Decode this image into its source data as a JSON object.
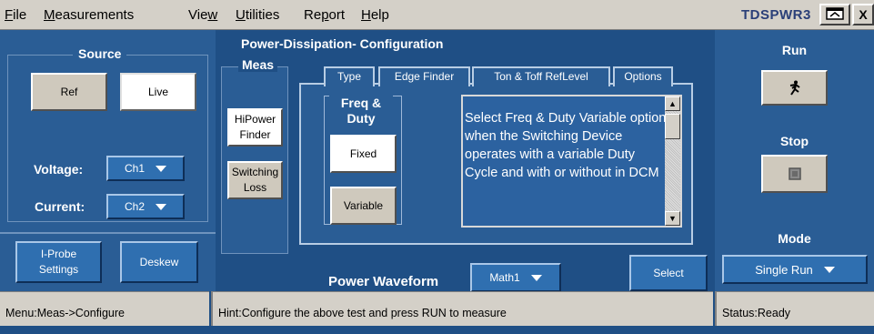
{
  "menu": {
    "items": [
      {
        "first": "F",
        "rest": "ile"
      },
      {
        "first": "M",
        "rest": "easurements"
      },
      {
        "pre": "Vie",
        "first": "w",
        "rest": ""
      },
      {
        "first": "U",
        "rest": "tilities"
      },
      {
        "pre": "Re",
        "first": "p",
        "rest": "ort"
      },
      {
        "first": "H",
        "rest": "elp"
      }
    ],
    "brand": "TDSPWR3",
    "close_label": "X"
  },
  "source": {
    "title": "Source",
    "ref_label": "Ref",
    "live_label": "Live",
    "voltage_label": "Voltage:",
    "voltage_value": "Ch1",
    "current_label": "Current:",
    "current_value": "Ch2"
  },
  "bottom_left": {
    "iprobe_label": "I-Probe Settings",
    "deskew_label": "Deskew"
  },
  "center": {
    "title": "Power-Dissipation- Configuration",
    "meas_label": "Meas",
    "hipower_label": "HiPower Finder",
    "switching_label": "Switching Loss",
    "tabs": [
      "Type",
      "Edge Finder",
      "Ton & Toff RefLevel",
      "Options"
    ],
    "freq_duty_label": "Freq & Duty",
    "fixed_label": "Fixed",
    "variable_label": "Variable",
    "description": "Select Freq & Duty Variable option when the Switching Device operates with a variable Duty Cycle and with or without in DCM",
    "power_waveform_label": "Power Waveform",
    "power_waveform_value": "Math1",
    "select_label": "Select"
  },
  "right": {
    "run_label": "Run",
    "stop_label": "Stop",
    "mode_label": "Mode",
    "mode_value": "Single Run"
  },
  "status": {
    "menu": "Menu:Meas->Configure",
    "hint": "Hint:Configure the above test and press RUN to measure",
    "state": "Status:Ready"
  },
  "icons": {
    "run": "running-man-icon",
    "stop": "stop-square-icon",
    "minimize": "minimize-window-icon",
    "close": "close-icon"
  }
}
